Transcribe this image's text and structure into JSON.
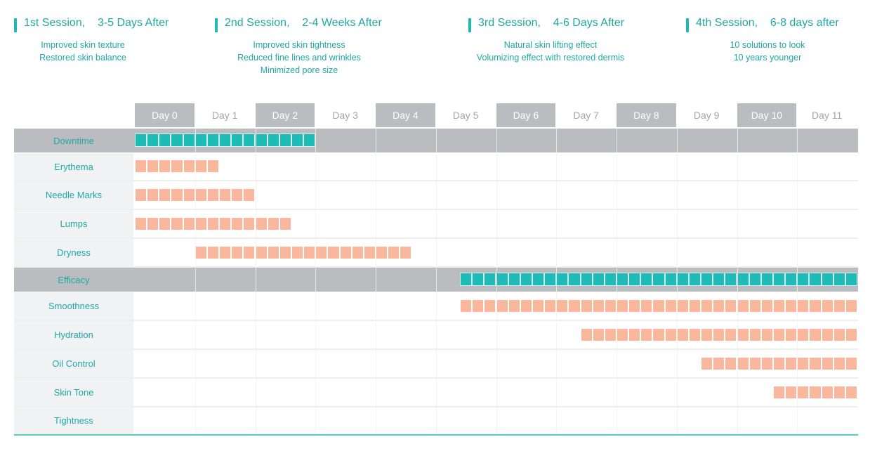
{
  "sessions": [
    {
      "title": "1st Session,    3-5 Days After",
      "lines": [
        "Improved skin texture",
        "Restored skin balance"
      ]
    },
    {
      "title": "2nd Session,    2-4 Weeks After",
      "lines": [
        "Improved skin tightness",
        "Reduced fine lines and wrinkles",
        "Minimized pore size"
      ]
    },
    {
      "title": "3rd Session,    4-6 Days After",
      "lines": [
        "Natural skin lifting effect",
        "Volumizing effect with restored dermis"
      ]
    },
    {
      "title": "4th Session,    6-8 days after",
      "lines": [
        "10 solutions to look",
        "10 years younger"
      ]
    }
  ],
  "colors": {
    "accent": "#1fbab5",
    "text_accent": "#1fa9a5",
    "group_bg": "#bbbcc0",
    "effect_block": "#f9b89d",
    "group_block": "#1fbcb7",
    "label_bg": "#f1f2f4"
  },
  "chart_data": {
    "type": "gantt",
    "title": "",
    "xlabel": "",
    "ylabel": "",
    "x_unit": "day",
    "blocks_per_day": 5,
    "x_range": [
      0,
      12
    ],
    "days": [
      "Day 0",
      "Day 1",
      "Day 2",
      "Day 3",
      "Day 4",
      "Day 5",
      "Day 6",
      "Day 7",
      "Day 8",
      "Day 9",
      "Day 10",
      "Day 11"
    ],
    "rows": [
      {
        "label": "Downtime",
        "kind": "group",
        "start": 0,
        "end": 3.0
      },
      {
        "label": "Erythema",
        "kind": "item",
        "start": 0,
        "end": 1.4
      },
      {
        "label": "Needle Marks",
        "kind": "item",
        "start": 0,
        "end": 2.0
      },
      {
        "label": "Lumps",
        "kind": "item",
        "start": 0,
        "end": 2.6
      },
      {
        "label": "Dryness",
        "kind": "item",
        "start": 1.0,
        "end": 4.6
      },
      {
        "label": "Efficacy",
        "kind": "group",
        "start": 5.4,
        "end": 12.0
      },
      {
        "label": "Smoothness",
        "kind": "item",
        "start": 5.4,
        "end": 12.0
      },
      {
        "label": "Hydration",
        "kind": "item",
        "start": 7.4,
        "end": 12.0
      },
      {
        "label": "Oil Control",
        "kind": "item",
        "start": 9.4,
        "end": 12.0
      },
      {
        "label": "Skin Tone",
        "kind": "item",
        "start": 10.6,
        "end": 12.0
      },
      {
        "label": "Tightness",
        "kind": "item",
        "start": null,
        "end": null
      }
    ]
  }
}
